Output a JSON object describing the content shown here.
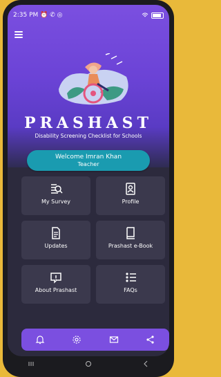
{
  "status_bar": {
    "time": "2:35 PM",
    "left_icons": "⏰ ✆ ◎"
  },
  "header": {
    "title": "PRASHAST",
    "subtitle": "Disability Screening Checklist for Schools"
  },
  "welcome": {
    "line1": "Welcome Imran Khan",
    "line2": "Teacher"
  },
  "menu_items": [
    {
      "label": "My Survey",
      "icon": "survey-icon"
    },
    {
      "label": "Profile",
      "icon": "profile-icon"
    },
    {
      "label": "Updates",
      "icon": "updates-icon"
    },
    {
      "label": "Prashast e-Book",
      "icon": "ebook-icon"
    },
    {
      "label": "About Prashast",
      "icon": "about-icon"
    },
    {
      "label": "FAQs",
      "icon": "faq-icon"
    }
  ],
  "bottom_nav": [
    "bell-icon",
    "settings-icon",
    "mail-icon",
    "share-icon"
  ],
  "colors": {
    "primary": "#7b4fe0",
    "card_bg": "#3b394d",
    "accent": "#1a9bb0",
    "bg": "#2c2a3d"
  }
}
